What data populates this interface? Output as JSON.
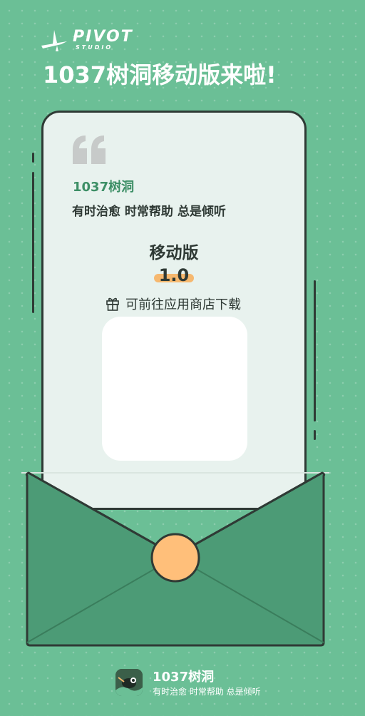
{
  "header": {
    "logo_text": "PIVOT",
    "logo_sub": "STUDIO",
    "headline": "1037树洞移动版来啦!"
  },
  "card": {
    "brand": "1037树洞",
    "slogan": "有时治愈 时常帮助 总是倾听",
    "version_label": "移动版",
    "version_number": "1.0",
    "store_text": "可前往应用商店下载"
  },
  "footer": {
    "app_name": "1037树洞",
    "slogan": "有时治愈 时常帮助 总是倾听"
  },
  "icons": {
    "logo": "pivot-plane-logo-icon",
    "quote": "quote-mark-icon",
    "gift": "gift-icon",
    "app": "app-icon"
  },
  "colors": {
    "background": "#6bbf96",
    "card": "#e8f2ee",
    "envelope": "#4c9b76",
    "outline": "#2f3a35",
    "brand_green": "#3d8f66",
    "seal": "#ffbf7a",
    "highlight": "#f6b86f"
  }
}
